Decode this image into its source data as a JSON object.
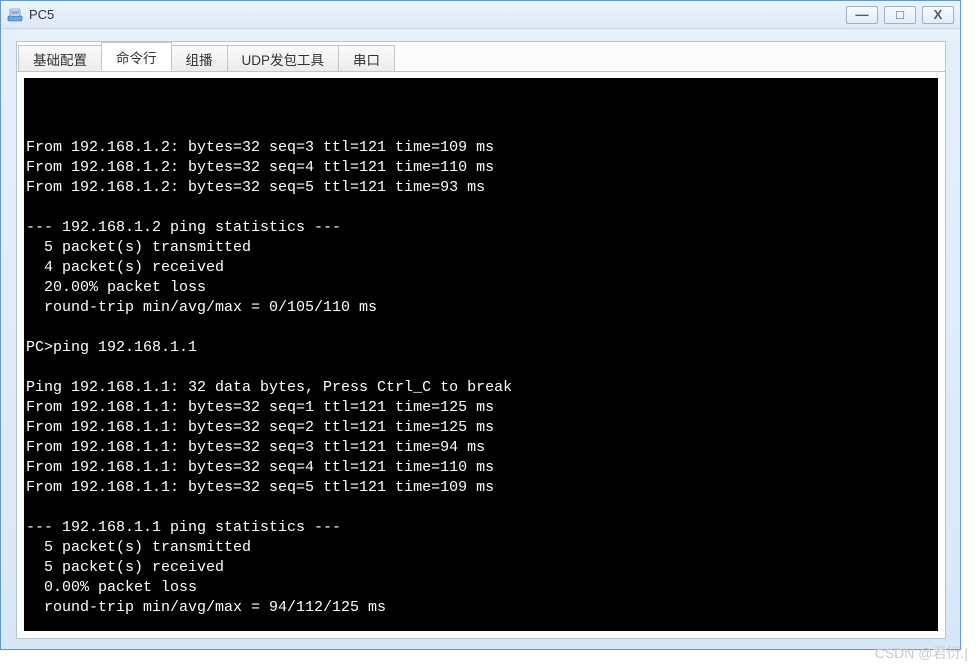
{
  "window": {
    "title": "PC5"
  },
  "win_controls": {
    "minimize": "—",
    "maximize": "□",
    "close": "X"
  },
  "tabs": [
    {
      "label": "基础配置",
      "active": false
    },
    {
      "label": "命令行",
      "active": true
    },
    {
      "label": "组播",
      "active": false
    },
    {
      "label": "UDP发包工具",
      "active": false
    },
    {
      "label": "串口",
      "active": false
    }
  ],
  "terminal_lines": [
    "From 192.168.1.2: bytes=32 seq=3 ttl=121 time=109 ms",
    "From 192.168.1.2: bytes=32 seq=4 ttl=121 time=110 ms",
    "From 192.168.1.2: bytes=32 seq=5 ttl=121 time=93 ms",
    "",
    "--- 192.168.1.2 ping statistics ---",
    "  5 packet(s) transmitted",
    "  4 packet(s) received",
    "  20.00% packet loss",
    "  round-trip min/avg/max = 0/105/110 ms",
    "",
    "PC>ping 192.168.1.1",
    "",
    "Ping 192.168.1.1: 32 data bytes, Press Ctrl_C to break",
    "From 192.168.1.1: bytes=32 seq=1 ttl=121 time=125 ms",
    "From 192.168.1.1: bytes=32 seq=2 ttl=121 time=125 ms",
    "From 192.168.1.1: bytes=32 seq=3 ttl=121 time=94 ms",
    "From 192.168.1.1: bytes=32 seq=4 ttl=121 time=110 ms",
    "From 192.168.1.1: bytes=32 seq=5 ttl=121 time=109 ms",
    "",
    "--- 192.168.1.1 ping statistics ---",
    "  5 packet(s) transmitted",
    "  5 packet(s) received",
    "  0.00% packet loss",
    "  round-trip min/avg/max = 94/112/125 ms",
    ""
  ],
  "prompt": "PC>",
  "watermark": "CSDN @君衍.|"
}
